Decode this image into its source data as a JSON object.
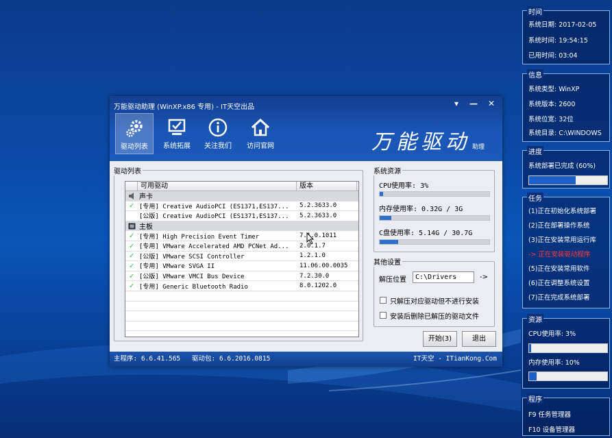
{
  "window": {
    "title": "万能驱动助理 (WinXP.x86 专用) - IT天空出品",
    "controls": [
      "▾",
      "—",
      "✕"
    ],
    "toolbar": [
      {
        "label": "驱动列表",
        "icon": "gears-icon",
        "selected": true
      },
      {
        "label": "系统拓展",
        "icon": "monitor-check-icon",
        "selected": false
      },
      {
        "label": "关注我们",
        "icon": "info-icon",
        "selected": false
      },
      {
        "label": "访问官网",
        "icon": "home-icon",
        "selected": false
      }
    ],
    "logo": {
      "text": "万能驱动",
      "suffix": "助理"
    }
  },
  "driver_list": {
    "legend": "驱动列表",
    "columns": [
      "可用驱动",
      "版本"
    ],
    "rows": [
      {
        "type": "category",
        "icon": "speaker-icon",
        "name": "声卡"
      },
      {
        "type": "item",
        "checked": true,
        "name": "[专用] Creative AudioPCI (ES1371,ES137...",
        "version": "5.2.3633.0"
      },
      {
        "type": "item",
        "checked": false,
        "name": "[公版] Creative AudioPCI (ES1371,ES137...",
        "version": "5.2.3633.0"
      },
      {
        "type": "category",
        "icon": "motherboard-icon",
        "name": "主板"
      },
      {
        "type": "item",
        "checked": true,
        "name": "[专用] High Precision Event Timer",
        "version": "7.1.0.1011"
      },
      {
        "type": "item",
        "checked": true,
        "name": "[专用] VMware Accelerated AMD PCNet Ad...",
        "version": "2.0.1.7"
      },
      {
        "type": "item",
        "checked": true,
        "name": "[公版] VMware SCSI Controller",
        "version": "1.2.1.0"
      },
      {
        "type": "item",
        "checked": true,
        "name": "[专用] VMware SVGA II",
        "version": "11.06.00.0035"
      },
      {
        "type": "item",
        "checked": true,
        "name": "[公版] VMware VMCI Bus Device",
        "version": "7.2.30.0"
      },
      {
        "type": "item",
        "checked": true,
        "name": "[专用] Generic Bluetooth Radio",
        "version": "8.0.1202.0"
      }
    ],
    "empty_rows": 5
  },
  "resources": {
    "legend": "系统资源",
    "cpu_label": "CPU使用率:  3%",
    "cpu_fraction": 0.03,
    "mem_label": "内存使用率: 0.32G / 3G",
    "mem_fraction": 0.107,
    "disk_label": "C盘使用率:  5.14G / 30.7G",
    "disk_fraction": 0.167
  },
  "settings": {
    "legend": "其他设置",
    "extract_label": "解压位置",
    "extract_value": "C:\\Drivers",
    "browse_label": "->",
    "opt1": "只解压对应驱动但不进行安装",
    "opt2": "安装后删除已解压的驱动文件"
  },
  "buttons": {
    "start": "开始(3)",
    "exit": "退出"
  },
  "footer": {
    "main_version": "主程序: 6.6.41.565",
    "pkg_version": "驱动包: 6.6.2016.0815",
    "site": "IT天空 - ITianKong.Com"
  },
  "side": {
    "time": {
      "title": "时间",
      "lines": [
        "系统日期:  2017-02-05",
        "系统时间:  19:54:15",
        "已用时间:  03:04"
      ]
    },
    "info": {
      "title": "信息",
      "lines": [
        "系统类型:  WinXP",
        "系统版本:  2600",
        "系统位宽:  32位",
        "系统目录:  C:\\WINDOWS"
      ]
    },
    "progress": {
      "title": "进度",
      "text": "系统部署已完成 (60%)",
      "fraction": 0.6
    },
    "tasks": {
      "title": "任务",
      "items": [
        "(1)正在初始化系统部署",
        "(2)正在部署操作系统",
        "(3)正在安装常用运行库",
        "-> 正在安装驱动程序",
        "(5)正在安装常用软件",
        "(6)正在调整系统设置",
        "(7)正在完成系统部署"
      ],
      "current_index": 3,
      "current_color": "#ff3b3b"
    },
    "res": {
      "title": "资源",
      "cpu": "CPU使用率:  3%",
      "cpu_fraction": 0.03,
      "mem": "内存使用率:  10%",
      "mem_fraction": 0.1
    },
    "prog": {
      "title": "程序",
      "lines": [
        "F9  任务管理器",
        "F10 设备管理器"
      ]
    }
  }
}
